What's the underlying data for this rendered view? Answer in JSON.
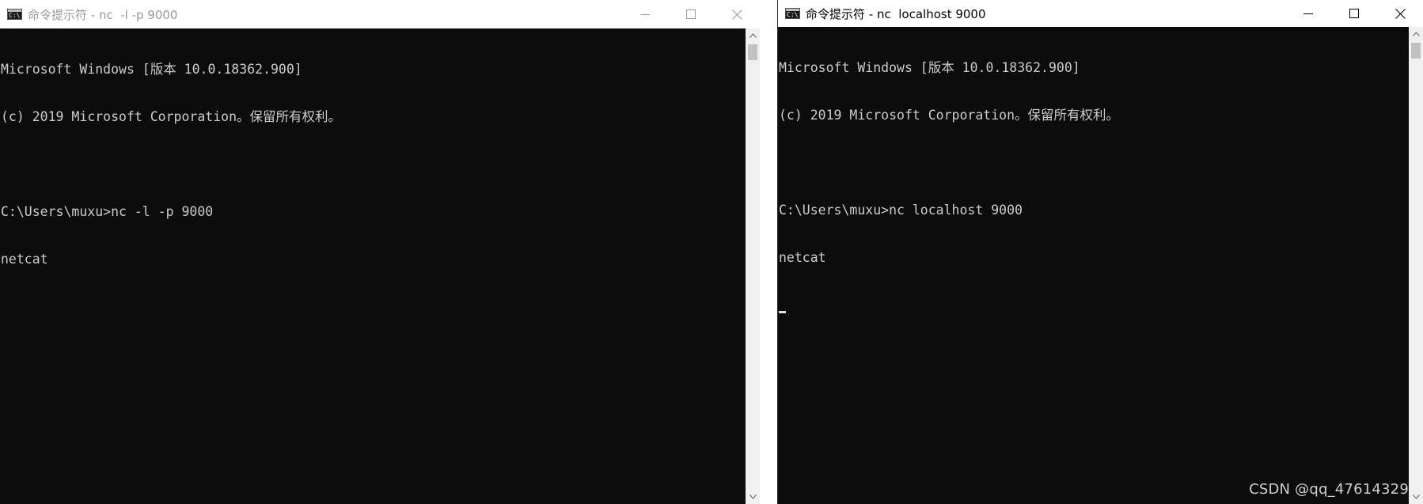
{
  "left_window": {
    "title": "命令提示符 - nc  -l -p 9000",
    "lines": [
      "Microsoft Windows [版本 10.0.18362.900]",
      "(c) 2019 Microsoft Corporation。保留所有权利。",
      "",
      "C:\\Users\\muxu>nc -l -p 9000",
      "netcat"
    ]
  },
  "right_window": {
    "title": "命令提示符 - nc  localhost 9000",
    "lines": [
      "Microsoft Windows [版本 10.0.18362.900]",
      "(c) 2019 Microsoft Corporation。保留所有权利。",
      "",
      "C:\\Users\\muxu>nc localhost 9000",
      "netcat"
    ]
  },
  "app_icon_glyph": "C:\\",
  "watermark": "CSDN @qq_47614329",
  "colors": {
    "console_bg": "#0c0c0c",
    "console_text": "#cccccc",
    "titlebar_bg": "#ffffff",
    "inactive_title": "#9a9a9a"
  },
  "icons": {
    "minimize": "minimize-icon",
    "maximize": "maximize-icon",
    "close": "close-icon",
    "scroll_up": "chevron-up-icon",
    "scroll_down": "chevron-down-icon"
  }
}
